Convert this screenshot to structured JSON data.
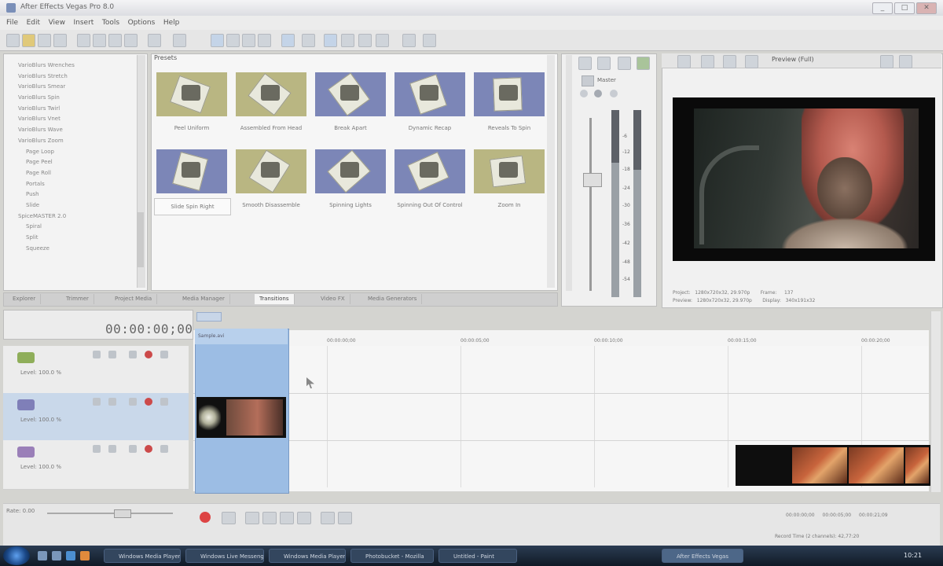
{
  "window": {
    "title": "After Effects Vegas Pro 8.0",
    "buttons": [
      "_",
      "□",
      "✕"
    ]
  },
  "menu": [
    "File",
    "Edit",
    "View",
    "Insert",
    "Tools",
    "Options",
    "Help"
  ],
  "explorer": {
    "items": [
      {
        "label": "VarioBlurs Wrenches",
        "type": "fx"
      },
      {
        "label": "VarioBlurs Stretch",
        "type": "fx"
      },
      {
        "label": "VarioBlurs Smear",
        "type": "fx"
      },
      {
        "label": "VarioBlurs Spin",
        "type": "fx"
      },
      {
        "label": "VarioBlurs Twirl",
        "type": "fx"
      },
      {
        "label": "VarioBlurs Vnet",
        "type": "fx"
      },
      {
        "label": "VarioBlurs Wave",
        "type": "fx"
      },
      {
        "label": "VarioBlurs Zoom",
        "type": "fx"
      },
      {
        "label": "Page Loop",
        "type": "sub"
      },
      {
        "label": "Page Peel",
        "type": "sub"
      },
      {
        "label": "Page Roll",
        "type": "sub"
      },
      {
        "label": "Portals",
        "type": "sub"
      },
      {
        "label": "Push",
        "type": "sub"
      },
      {
        "label": "Slide",
        "type": "sub"
      },
      {
        "label": "SpiceMASTER 2.0",
        "type": "fx"
      },
      {
        "label": "Spiral",
        "type": "sub"
      },
      {
        "label": "Split",
        "type": "sub"
      },
      {
        "label": "Squeeze",
        "type": "sub"
      }
    ]
  },
  "transitions": {
    "title": "Presets",
    "tiles": [
      {
        "label": "Peel Uniform",
        "color": "#b9b682"
      },
      {
        "label": "Assembled From Head",
        "color": "#b9b682"
      },
      {
        "label": "Break Apart",
        "color": "#7c86b7"
      },
      {
        "label": "Dynamic Recap",
        "color": "#7c86b7"
      },
      {
        "label": "Reveals To Spin",
        "color": "#7c86b7"
      },
      {
        "label": "Slide Spin Right",
        "color": "#7c86b7"
      },
      {
        "label": "Smooth Disassemble",
        "color": "#b9b682"
      },
      {
        "label": "Spinning Lights",
        "color": "#7c86b7"
      },
      {
        "label": "Spinning Out Of Control",
        "color": "#7c86b7"
      },
      {
        "label": "Zoom In",
        "color": "#b9b682"
      }
    ]
  },
  "tabs": [
    "Explorer",
    "Trimmer",
    "Project Media",
    "Media Manager",
    "Transitions",
    "Video FX",
    "Media Generators"
  ],
  "mixer": {
    "master_label": "Master",
    "scale": [
      "-6",
      "-12",
      "-18",
      "-24",
      "-30",
      "-36",
      "-42",
      "-48",
      "-54"
    ],
    "levels": [
      0.72,
      0.68
    ]
  },
  "preview": {
    "mode": "Preview (Full)",
    "info": [
      "Project:   1280x720x32, 29.970p       Frame:     137",
      "Preview:   1280x720x32, 29.970p       Display:   340x191x32"
    ]
  },
  "timeline": {
    "timecode": "00:00:00;00",
    "clip_label": "Sample.avi",
    "ruler": [
      "00:00:00;00",
      "00:00:05;00",
      "00:00:10;00",
      "00:00:15;00",
      "00:00:20;00"
    ],
    "tracks": [
      {
        "level": "Level: 100.0 %",
        "icon_color": "#8fae5a"
      },
      {
        "level": "Level: 100.0 %",
        "icon_color": "#7f7fb8"
      },
      {
        "level": "Level: 100.0 %",
        "icon_color": "#9a7fb8"
      }
    ],
    "rate": "Rate: 0.00",
    "bottom_times": "00:00:00;00   00:00:05;00   00:00:21;09",
    "record_time": "Record Time (2 channels): 42,77:20"
  },
  "taskbar": {
    "items": [
      {
        "label": "Windows Media Player",
        "active": false
      },
      {
        "label": "Windows Live Messenger",
        "active": false
      },
      {
        "label": "Windows Media Player",
        "active": false
      },
      {
        "label": "Photobucket - Mozilla",
        "active": false
      },
      {
        "label": "Untitled - Paint",
        "active": false
      },
      {
        "label": "After Effects Vegas",
        "active": true
      }
    ],
    "clock": "10:21"
  }
}
